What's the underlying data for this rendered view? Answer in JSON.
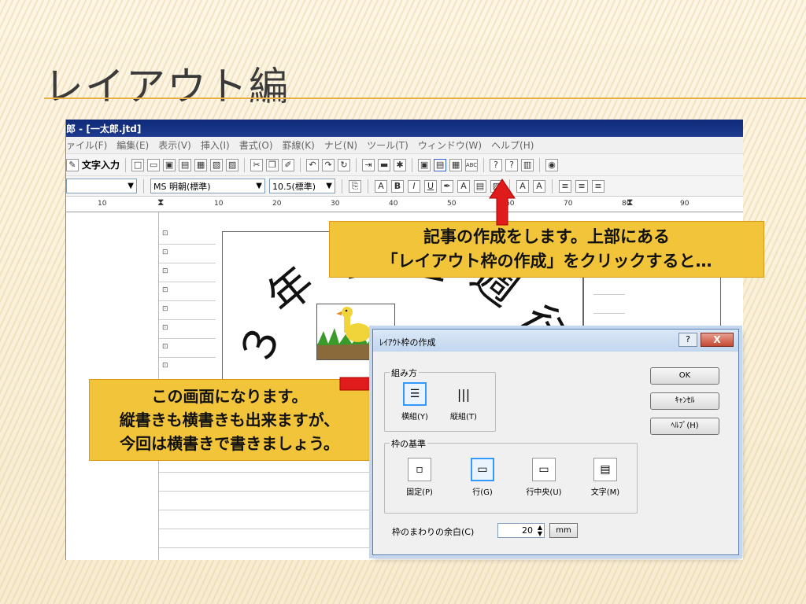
{
  "slide": {
    "title": "レイアウト編"
  },
  "window": {
    "title": "郎 - [一太郎.jtd]",
    "menu": [
      "ァイル(F)",
      "編集(E)",
      "表示(V)",
      "挿入(I)",
      "書式(O)",
      "罫線(K)",
      "ナビ(N)",
      "ツール(T)",
      "ウィンドウ(W)",
      "ヘルプ(H)"
    ],
    "toolbar": {
      "text_input_label": "文字入力"
    },
    "format_bar": {
      "style_value": "",
      "font_value": "MS 明朝(標準)",
      "size_value": "10.5(標準)"
    },
    "ruler_ticks": [
      "10",
      "10",
      "20",
      "30",
      "40",
      "50",
      "60",
      "70",
      "80",
      "90"
    ],
    "headline_chars": [
      "３",
      "年",
      "Ｂ",
      "組",
      "週",
      "行"
    ]
  },
  "callouts": {
    "top": [
      "記事の作成をします。上部にある",
      "「レイアウト枠の作成」をクリックすると…"
    ],
    "left": [
      "この画面になります。",
      "縦書きも横書きも出来ますが、",
      "今回は横書きで書きましょう。"
    ]
  },
  "dialog": {
    "title": "ﾚｲｱｳﾄ枠の作成",
    "help_label": "?",
    "close_label": "X",
    "group_direction": {
      "label": "組み方",
      "options": [
        {
          "label": "横組(Y)",
          "selected": true
        },
        {
          "label": "縦組(T)",
          "selected": false
        }
      ]
    },
    "group_base": {
      "label": "枠の基準",
      "options": [
        {
          "label": "固定(P)",
          "selected": false
        },
        {
          "label": "行(G)",
          "selected": true
        },
        {
          "label": "行中央(U)",
          "selected": false
        },
        {
          "label": "文字(M)",
          "selected": false
        }
      ]
    },
    "margin_label": "枠のまわりの余白(C)",
    "margin_value": "20",
    "unit_label": "mm",
    "ok_label": "OK",
    "cancel_label": "ｷｬﾝｾﾙ",
    "help_button_label": "ﾍﾙﾌﾟ(H)"
  },
  "colors": {
    "callout": "#f2c43a",
    "arrow": "#e01b1b",
    "title_line": "#e8b040"
  }
}
